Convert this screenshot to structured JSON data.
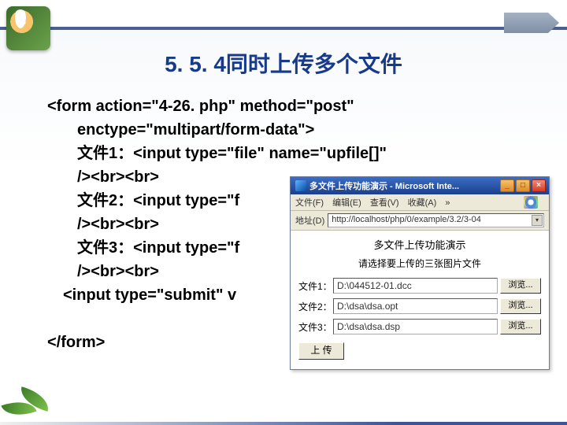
{
  "title": "5. 5. 4同时上传多个文件",
  "code": {
    "l1": "<form action=\"4-26. php\" method=\"post\"",
    "l2": "enctype=\"multipart/form-data\">",
    "l3": "文件1：<input type=\"file\" name=\"upfile[]\"",
    "l3b": "/><br><br>",
    "l4": "文件2：<input type=\"f",
    "l4b": "/><br><br>",
    "l5": "文件3：<input type=\"f",
    "l5b": "/><br><br>",
    "l6": "<input type=\"submit\" v",
    "l7": "</form>"
  },
  "ie": {
    "title": "多文件上传功能演示 - Microsoft Inte...",
    "menu": {
      "file": "文件(F)",
      "edit": "编辑(E)",
      "view": "查看(V)",
      "fav": "收藏(A)",
      "more": "»"
    },
    "addr_label": "地址(D)",
    "addr_value": "http://localhost/php/0/example/3.2/3-04",
    "addr_drop": "▾",
    "heading": "多文件上传功能演示",
    "sub": "请选择要上传的三张图片文件",
    "rows": [
      {
        "label": "文件1：",
        "value": "D:\\044512-01.dcc"
      },
      {
        "label": "文件2：",
        "value": "D:\\dsa\\dsa.opt"
      },
      {
        "label": "文件3：",
        "value": "D:\\dsa\\dsa.dsp"
      }
    ],
    "browse": "浏览...",
    "upload": "上 传",
    "btn_min": "_",
    "btn_max": "□",
    "btn_close": "×"
  }
}
